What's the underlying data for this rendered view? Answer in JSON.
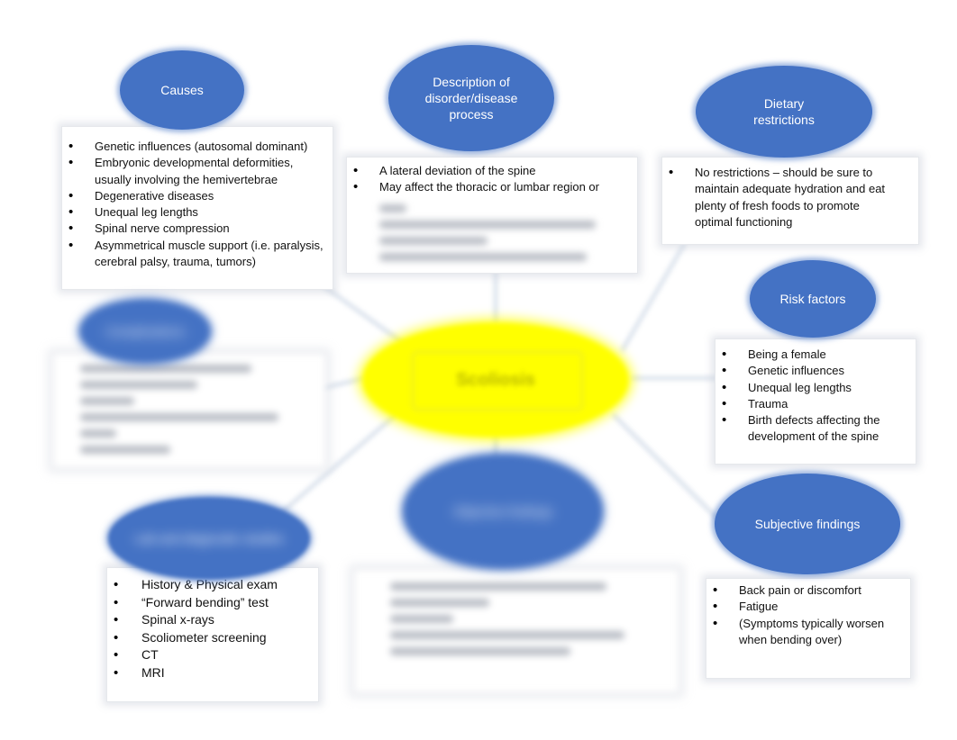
{
  "document": {
    "type": "concept-map",
    "center_topic": {
      "label": "Scoliosis",
      "blurred": true,
      "color": "#ffff00"
    },
    "accent_color": "#4472c4",
    "nodes": {
      "causes": {
        "title": "Causes",
        "items": [
          "Genetic influences (autosomal dominant)",
          "Embryonic developmental deformities, usually involving the hemivertebrae",
          "Degenerative diseases",
          "Unequal leg lengths",
          "Spinal nerve compression",
          "Asymmetrical muscle support (i.e. paralysis, cerebral palsy, trauma, tumors)"
        ]
      },
      "description": {
        "title": "Description of\ndisorder/disease\nprocess",
        "items": [
          "A lateral deviation of the spine",
          "May affect the thoracic or lumbar region or"
        ],
        "blurred_continuation": true
      },
      "dietary": {
        "title": "Dietary\nrestrictions",
        "items": [
          "No restrictions – should be sure to maintain adequate hydration and eat plenty of fresh foods to promote optimal functioning"
        ]
      },
      "risk_factors": {
        "title": "Risk factors",
        "items": [
          "Being a female",
          "Genetic influences",
          "Unequal leg lengths",
          "Trauma",
          "Birth defects affecting the development of the spine"
        ]
      },
      "subjective": {
        "title": "Subjective findings",
        "items": [
          "Back pain or discomfort",
          "Fatigue",
          "(Symptoms typically worsen when bending over)"
        ]
      },
      "diagnostics": {
        "title": "Lab and diagnostic studies",
        "title_blurred": true,
        "items": [
          "History & Physical exam",
          "“Forward bending” test",
          "Spinal x-rays",
          "Scoliometer screening",
          "CT",
          "MRI"
        ]
      },
      "left_middle": {
        "title": "Complications",
        "blurred": true
      },
      "bottom_middle": {
        "title": "Objective findings",
        "blurred": true
      }
    }
  }
}
